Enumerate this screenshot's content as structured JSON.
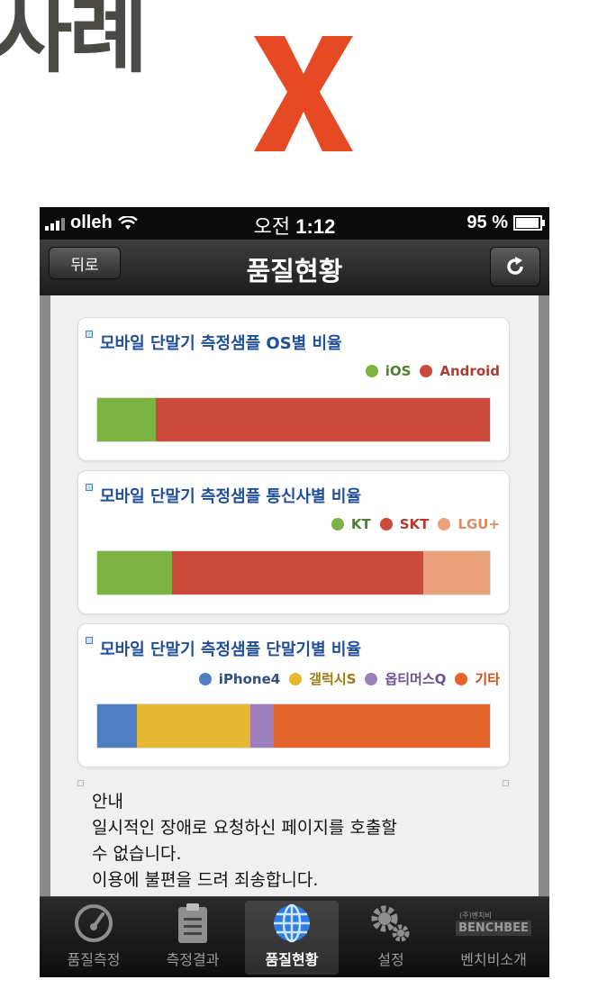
{
  "slide": {
    "title": "사례",
    "mark": "X",
    "mark_color": "#e64a25"
  },
  "status_bar": {
    "carrier": "olleh",
    "time_prefix": "오전",
    "time": "1:12",
    "battery": "95 %"
  },
  "nav": {
    "back_label": "뒤로",
    "title": "품질현황",
    "refresh_icon": "refresh-icon"
  },
  "cards": [
    {
      "title": "모바일 단말기 측정샘플 OS별 비율",
      "legend": [
        {
          "label": "iOS",
          "color": "#7cb342",
          "text_color": "#4f7f2c"
        },
        {
          "label": "Android",
          "color": "#cc4a3c",
          "text_color": "#b23a2e"
        }
      ],
      "shares": [
        0.15,
        0.85
      ]
    },
    {
      "title": "모바일 단말기 측정샘플 통신사별 비율",
      "legend": [
        {
          "label": "KT",
          "color": "#7cb342",
          "text_color": "#4f7f2c"
        },
        {
          "label": "SKT",
          "color": "#cc4a3c",
          "text_color": "#b23a2e"
        },
        {
          "label": "LGU+",
          "color": "#e9a27b",
          "text_color": "#d98c5f"
        }
      ],
      "shares": [
        0.19,
        0.64,
        0.17
      ]
    },
    {
      "title": "모바일 단말기 측정샘플 단말기별 비율",
      "legend": [
        {
          "label": "iPhone4",
          "color": "#4f7fc0",
          "text_color": "#2f4f7f"
        },
        {
          "label": "갤럭시S",
          "color": "#e6b733",
          "text_color": "#a07a12"
        },
        {
          "label": "옵티머스Q",
          "color": "#9d7fbd",
          "text_color": "#6e4f93"
        },
        {
          "label": "기타",
          "color": "#e3642b",
          "text_color": "#c94e1c"
        }
      ],
      "shares": [
        0.1,
        0.29,
        0.06,
        0.55
      ]
    }
  ],
  "notice": {
    "heading": "안내",
    "line1": "일시적인 장애로 요청하신 페이지를 호출할",
    "line2": "수 없습니다.",
    "line3": "이용에 불편을 드려 죄송합니다."
  },
  "tabs": [
    {
      "label": "품질측정",
      "icon": "speedometer-icon"
    },
    {
      "label": "측정결과",
      "icon": "clipboard-icon"
    },
    {
      "label": "품질현황",
      "icon": "globe-icon",
      "active": true
    },
    {
      "label": "설정",
      "icon": "gears-icon"
    },
    {
      "label": "벤치비소개",
      "icon": "benchbee-logo-icon",
      "logo_text": "BENCHBEE",
      "logo_small": "(주)벤치비"
    }
  ]
}
